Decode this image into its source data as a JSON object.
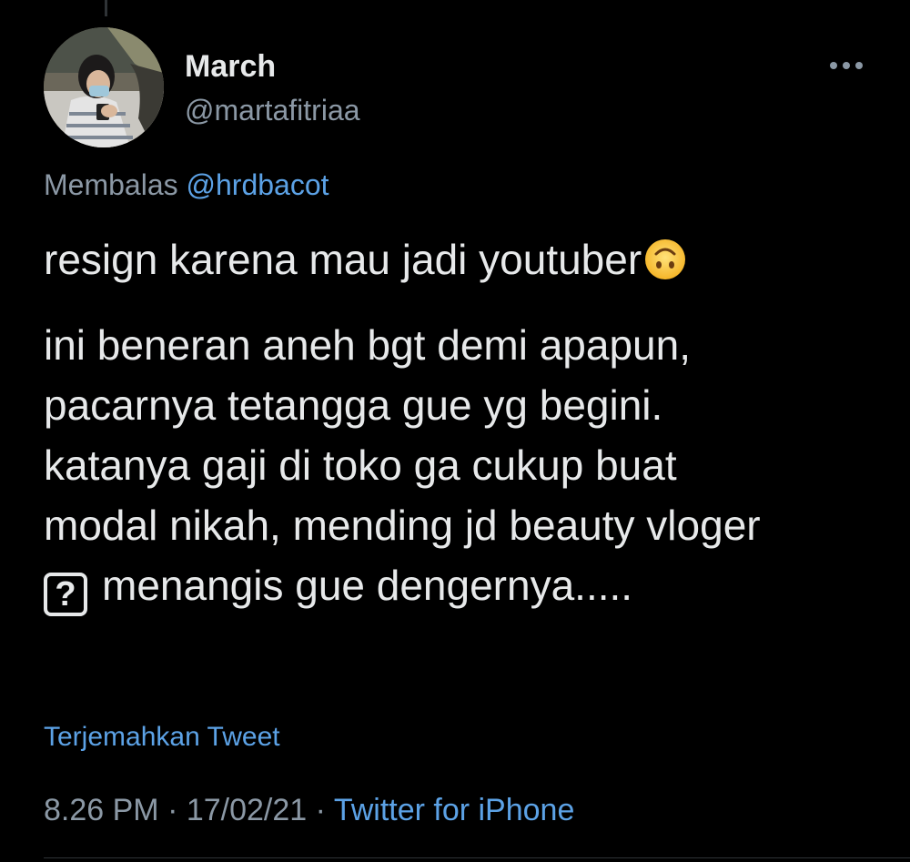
{
  "tweet": {
    "author": {
      "display_name": "March",
      "handle": "@martafitriaa"
    },
    "reply_prefix": "Membalas",
    "reply_to": "@hrdbacot",
    "text_first": "resign karena mau jadi youtuber",
    "text_first_emoji": "upside-down-face-emoji",
    "text_second_lines": "ini beneran aneh bgt demi apapun,\npacarnya tetangga gue yg begini.\nkatanya gaji di toko ga cukup buat\nmodal nikah, mending jd beauty vloger",
    "unknown_glyph": "?",
    "text_last_line": "menangis gue dengernya.....",
    "translate_label": "Terjemahkan Tweet",
    "time": "8.26 PM",
    "separator": " · ",
    "date": "17/02/21",
    "source": "Twitter for iPhone"
  },
  "icons": {
    "more": "more-horizontal-icon",
    "avatar": "profile-photo"
  },
  "colors": {
    "background": "#000000",
    "primary_text": "#e7e9ea",
    "secondary_text": "#8b98a5",
    "link": "#5ca2e6"
  }
}
